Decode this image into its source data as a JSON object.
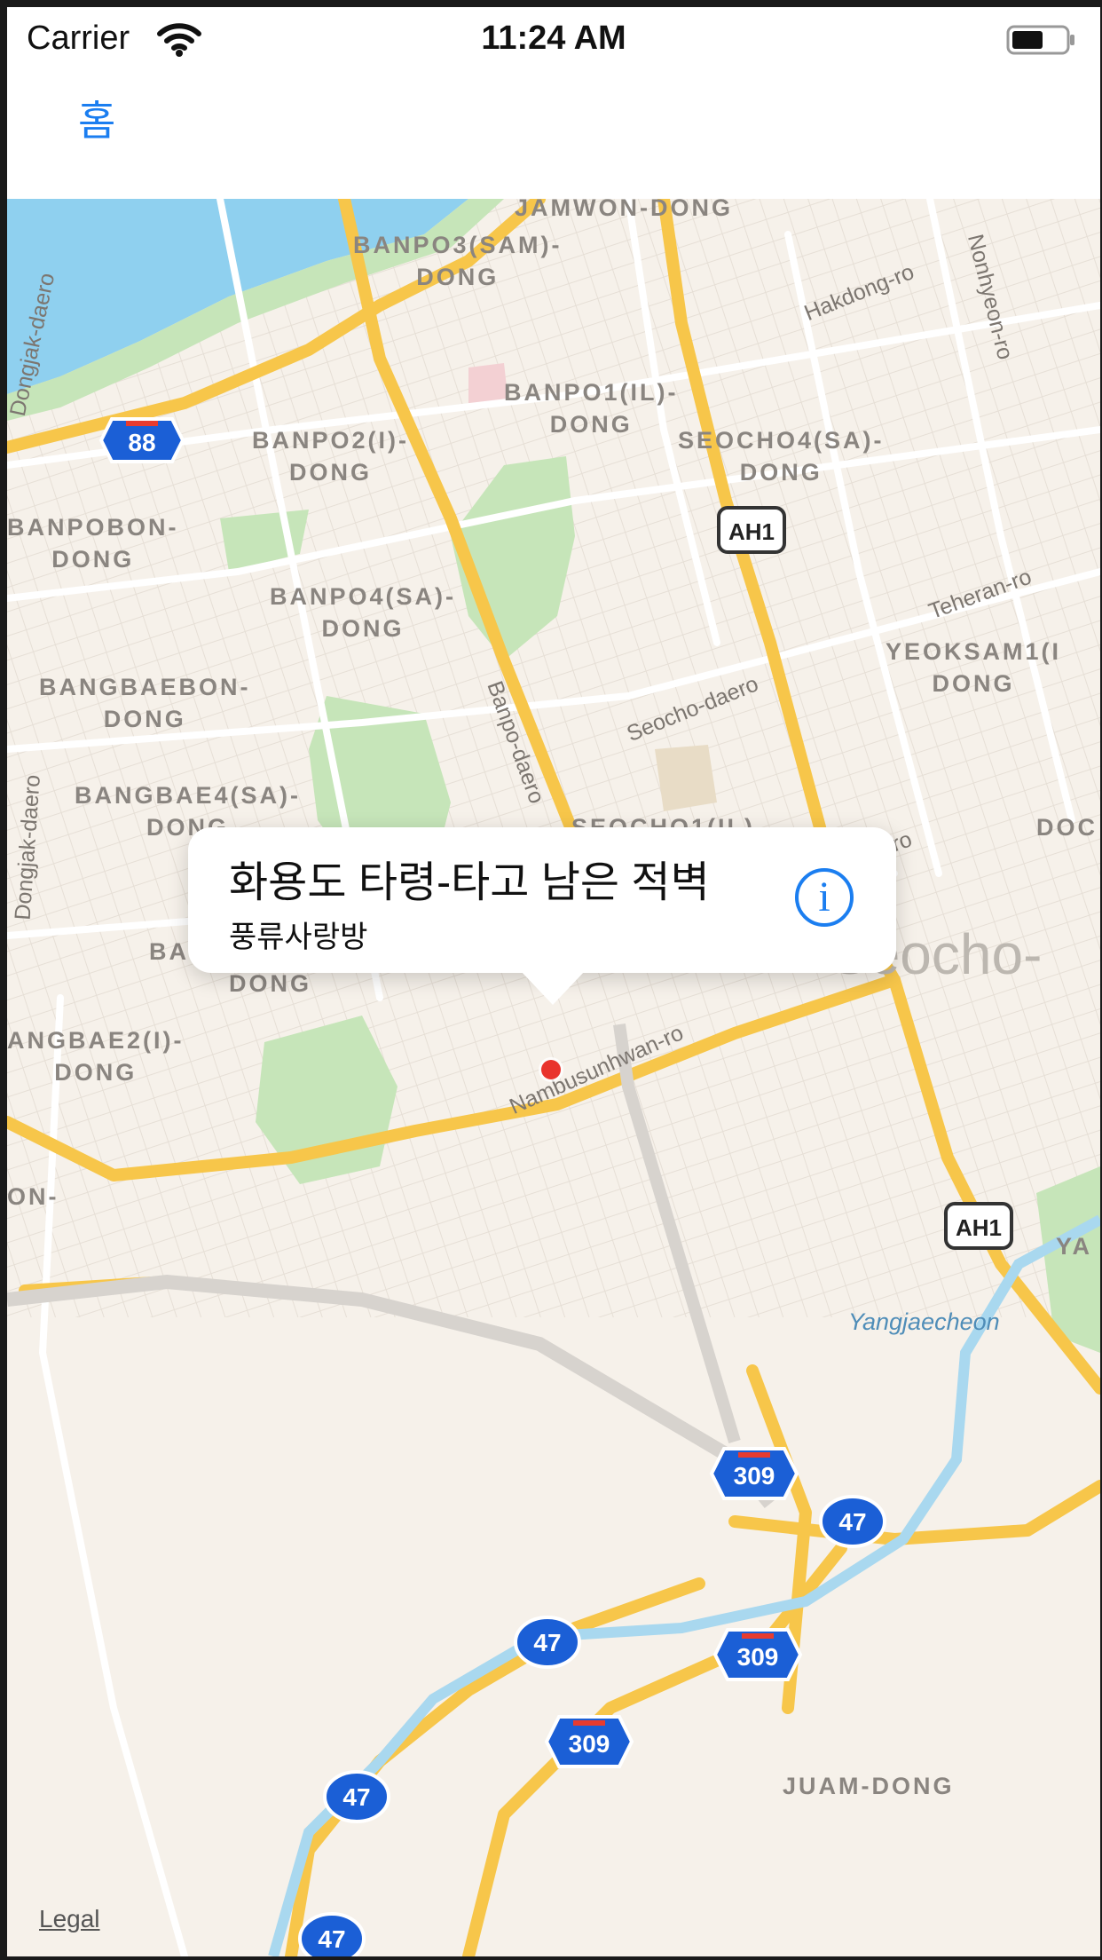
{
  "status_bar": {
    "carrier": "Carrier",
    "time": "11:24 AM"
  },
  "nav_bar": {
    "back_label": "홈"
  },
  "map": {
    "districts": [
      {
        "text": "JAMWON-DONG"
      },
      {
        "text": "BANPO3(SAM)-\nDONG"
      },
      {
        "text": "BANPO1(IL)-\nDONG"
      },
      {
        "text": "BANPO2(I)-\nDONG"
      },
      {
        "text": "SEOCHO4(SA)-\nDONG"
      },
      {
        "text": "BANPOBON-\nDONG"
      },
      {
        "text": "BANPO4(SA)-\nDONG"
      },
      {
        "text": "YEOKSAM1(I\nDONG"
      },
      {
        "text": "BANGBAEBON-\nDONG"
      },
      {
        "text": "BANGBAE4(SA)-\nDONG"
      },
      {
        "text": "SEOCHO1(IL)-"
      },
      {
        "text": "DOC"
      },
      {
        "text": "BA"
      },
      {
        "text": "DONG"
      },
      {
        "text": "ANGBAE2(I)-\nDONG"
      },
      {
        "text": "ON-"
      },
      {
        "text": "YA"
      },
      {
        "text": "JUAM-DONG"
      }
    ],
    "roads": [
      {
        "text": "Dongjak-daero"
      },
      {
        "text": "Hakdong-ro"
      },
      {
        "text": "Nonhyeon-ro"
      },
      {
        "text": "Teheran-ro"
      },
      {
        "text": "Seocho-daero"
      },
      {
        "text": "Banpo-daero"
      },
      {
        "text": "Dongjak-daero"
      },
      {
        "text": "Nambusunhwan-ro"
      },
      {
        "text": "ro"
      }
    ],
    "water_label": "Yangjaecheon",
    "area_label": "Seocho-",
    "shields": {
      "route_88": "88",
      "ah1_a": "AH1",
      "ah1_b": "AH1",
      "route_309_a": "309",
      "route_309_b": "309",
      "route_309_c": "309",
      "route_47_a": "47",
      "route_47_b": "47",
      "route_47_c": "47",
      "route_47_d": "47"
    },
    "legal_label": "Legal"
  },
  "callout": {
    "title": "화용도 타령-타고 남은 적벽",
    "subtitle": "풍류사랑방",
    "info_icon": "info-icon"
  },
  "colors": {
    "accent": "#1b7ef0",
    "land": "#f6f1ea",
    "water": "#8fd0ef",
    "park": "#c6e5b9",
    "highway": "#f7c64a",
    "pin": "#e9332c"
  }
}
